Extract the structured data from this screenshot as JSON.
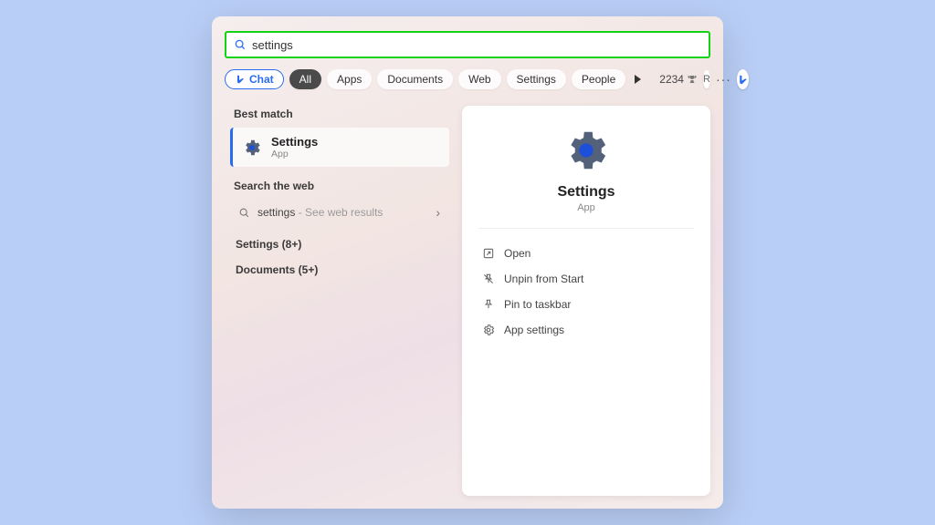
{
  "search": {
    "value": "settings"
  },
  "filters": {
    "chat": "Chat",
    "tabs": [
      "All",
      "Apps",
      "Documents",
      "Web",
      "Settings",
      "People"
    ],
    "active_index": 0,
    "points": "2234",
    "user_initial": "R"
  },
  "left": {
    "best_match_label": "Best match",
    "best": {
      "title": "Settings",
      "sub": "App"
    },
    "search_web_label": "Search the web",
    "web_row": {
      "term": "settings",
      "suffix": " - See web results"
    },
    "categories": [
      {
        "label": "Settings (8+)"
      },
      {
        "label": "Documents (5+)"
      }
    ]
  },
  "detail": {
    "title": "Settings",
    "sub": "App",
    "actions": [
      {
        "label": "Open",
        "icon": "open"
      },
      {
        "label": "Unpin from Start",
        "icon": "unpin"
      },
      {
        "label": "Pin to taskbar",
        "icon": "pin"
      },
      {
        "label": "App settings",
        "icon": "gear"
      }
    ]
  }
}
